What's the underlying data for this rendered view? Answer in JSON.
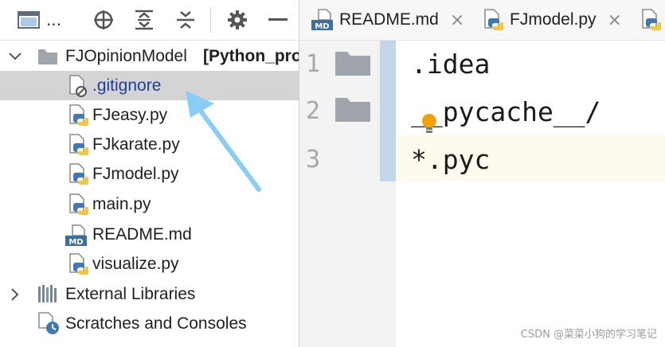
{
  "toolbar": {
    "view_label": "...",
    "icons": [
      "window-icon",
      "locate-icon",
      "expand-all-icon",
      "collapse-all-icon",
      "gear-icon",
      "minimize-icon"
    ]
  },
  "tree": {
    "root": {
      "name": "FJOpinionModel",
      "suffix": "[Python_pro"
    },
    "files": [
      {
        "name": ".gitignore",
        "icon": "gitignore-file-icon",
        "selected": true
      },
      {
        "name": "FJeasy.py",
        "icon": "python-file-icon"
      },
      {
        "name": "FJkarate.py",
        "icon": "python-file-icon"
      },
      {
        "name": "FJmodel.py",
        "icon": "python-file-icon"
      },
      {
        "name": "main.py",
        "icon": "python-file-icon"
      },
      {
        "name": "README.md",
        "icon": "markdown-file-icon"
      },
      {
        "name": "visualize.py",
        "icon": "python-file-icon"
      }
    ],
    "external_libraries": "External Libraries",
    "scratches": "Scratches and Consoles"
  },
  "tabs": [
    {
      "label": "README.md",
      "icon": "markdown-file-icon",
      "close": "×"
    },
    {
      "label": "FJmodel.py",
      "icon": "python-file-icon",
      "close": "×"
    },
    {
      "label": "",
      "icon": "python-file-icon"
    }
  ],
  "editor": {
    "line_numbers": [
      "1",
      "2",
      "3"
    ],
    "lines": [
      ".idea",
      "__pycache__/",
      "*.pyc"
    ],
    "intention_icon": "lightbulb-icon"
  },
  "watermark": "CSDN @菜菜小狗的学习笔记",
  "colors": {
    "selection": "#d4d4d4",
    "gitignore_text": "#1f3f9f",
    "arrow": "#87cdf5",
    "gutter_stripe": "#c3d6ea",
    "caret_row": "#fdfbee",
    "python_blue": "#3f78b4",
    "python_yellow": "#f4c63d",
    "folder": "#9fa5ab"
  }
}
